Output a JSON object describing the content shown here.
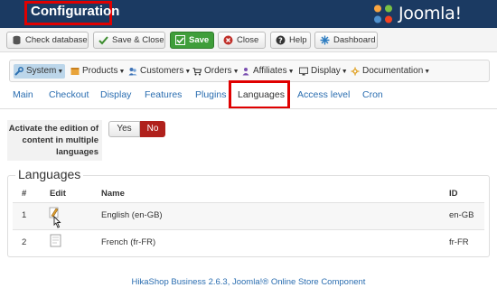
{
  "header": {
    "title": "Configuration",
    "logo_text": "Joomla!"
  },
  "toolbar": {
    "check_database": "Check database",
    "save_close": "Save & Close",
    "save": "Save",
    "close": "Close",
    "help": "Help",
    "dashboard": "Dashboard"
  },
  "menu": {
    "items": [
      "System",
      "Products",
      "Customers",
      "Orders",
      "Affiliates",
      "Display",
      "Documentation"
    ]
  },
  "tabs": [
    "Main",
    "Checkout",
    "Display",
    "Features",
    "Plugins",
    "Languages",
    "Access level",
    "Cron"
  ],
  "setting": {
    "label": "Activate the edition of content in multiple languages",
    "yes": "Yes",
    "no": "No"
  },
  "languages": {
    "legend": "Languages",
    "columns": [
      "#",
      "Edit",
      "Name",
      "ID"
    ],
    "rows": [
      {
        "num": "1",
        "name": "English (en-GB)",
        "id": "en-GB"
      },
      {
        "num": "2",
        "name": "French (fr-FR)",
        "id": "fr-FR"
      }
    ]
  },
  "footer": "HikaShop Business 2.6.3, Joomla!® Online Store Component",
  "colors": {
    "header_bg": "#1b3a62",
    "highlight_red": "#e00000",
    "save_green": "#3f9e3a",
    "no_red": "#b0211c",
    "link_blue": "#2a6db0"
  }
}
